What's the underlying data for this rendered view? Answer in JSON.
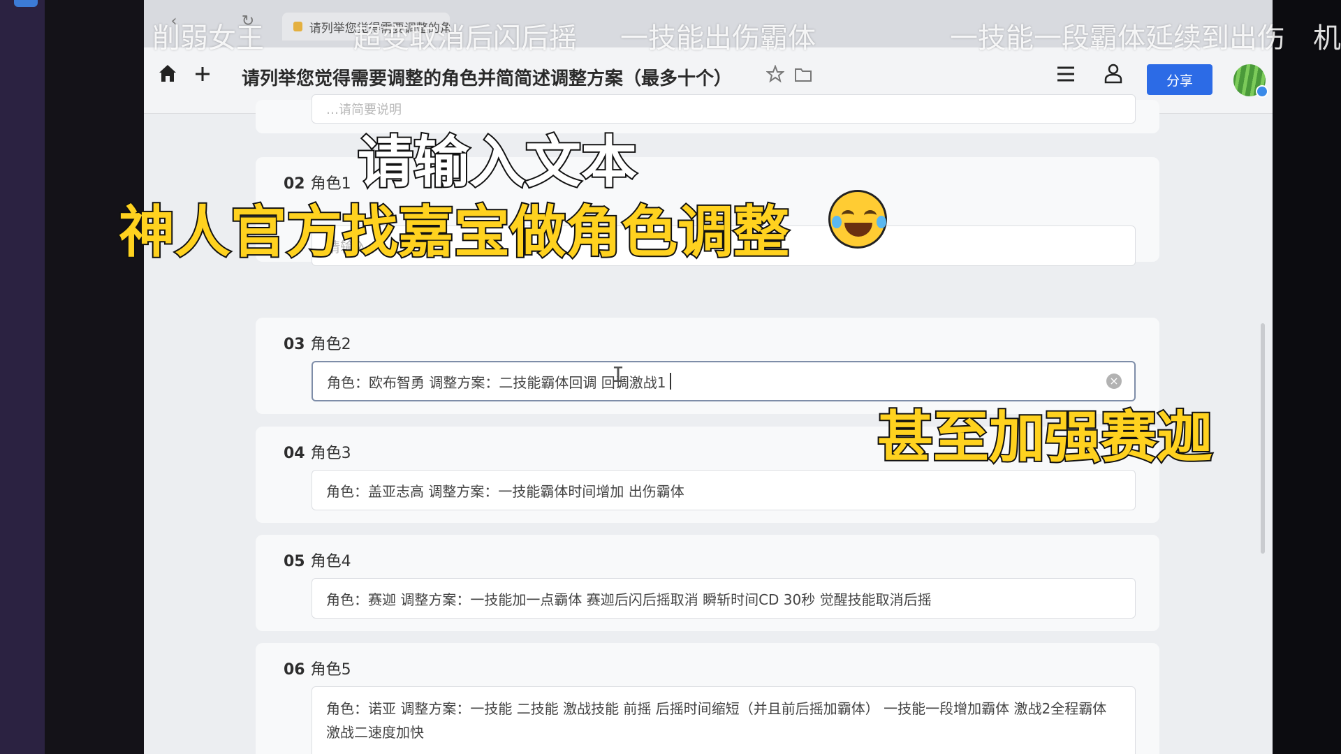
{
  "browser": {
    "tab_label": "请列举您觉得需要调整的角色",
    "tab_controls": [
      "‹",
      "↻"
    ]
  },
  "toolbar": {
    "doc_title": "请列举您觉得需要调整的角色并简简述调整方案（最多十个）",
    "share_label": "分享"
  },
  "danmaku": [
    "削弱女王",
    "超变取消后闪后摇",
    "一技能出伤霸体",
    "一技能一段霸体延续到出伤",
    "机"
  ],
  "captions": {
    "line1": "请输入文本",
    "line2": "神人官方找嘉宝做角色调整",
    "line3": "甚至加强赛迦"
  },
  "form": {
    "top_partial_text": "…请简要说明",
    "questions": [
      {
        "num": "02",
        "label": "角色1",
        "value": "",
        "placeholder": "请输入"
      },
      {
        "num": "03",
        "label": "角色2",
        "value": "角色：欧布智勇 调整方案：二技能霸体回调 回调激战1",
        "placeholder": ""
      },
      {
        "num": "04",
        "label": "角色3",
        "value": "角色：盖亚志高 调整方案：一技能霸体时间增加 出伤霸体",
        "placeholder": ""
      },
      {
        "num": "05",
        "label": "角色4",
        "value": "角色：赛迦 调整方案：一技能加一点霸体 赛迦后闪后摇取消 瞬斩时间CD 30秒 觉醒技能取消后摇",
        "placeholder": ""
      },
      {
        "num": "06",
        "label": "角色5",
        "value": "角色：诺亚 调整方案：一技能 二技能 激战技能 前摇 后摇时间缩短（并且前后摇加霸体） 一技能一段增加霸体 激战2全程霸体 激战二速度加快",
        "placeholder": ""
      }
    ]
  },
  "colors": {
    "share_button": "#2c6be6",
    "caption_yellow": "#ffd21f"
  }
}
